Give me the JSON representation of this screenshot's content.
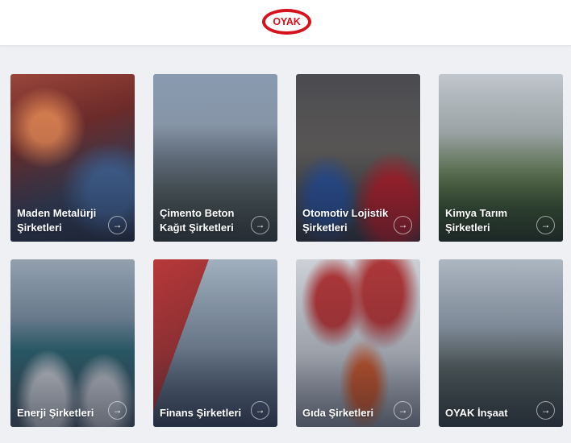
{
  "header": {
    "logo_text": "OYAK",
    "brand_color": "#d5121e"
  },
  "cards": [
    {
      "title": "Maden Metalürji Şirketleri",
      "arrow": "→"
    },
    {
      "title": "Çimento Beton Kağıt Şirketleri",
      "arrow": "→"
    },
    {
      "title": "Otomotiv Lojistik Şirketleri",
      "arrow": "→"
    },
    {
      "title": "Kimya Tarım Şirketleri",
      "arrow": "→"
    },
    {
      "title": "Enerji Şirketleri",
      "arrow": "→"
    },
    {
      "title": "Finans Şirketleri",
      "arrow": "→"
    },
    {
      "title": "Gıda Şirketleri",
      "arrow": "→"
    },
    {
      "title": "OYAK İnşaat",
      "arrow": "→"
    }
  ]
}
